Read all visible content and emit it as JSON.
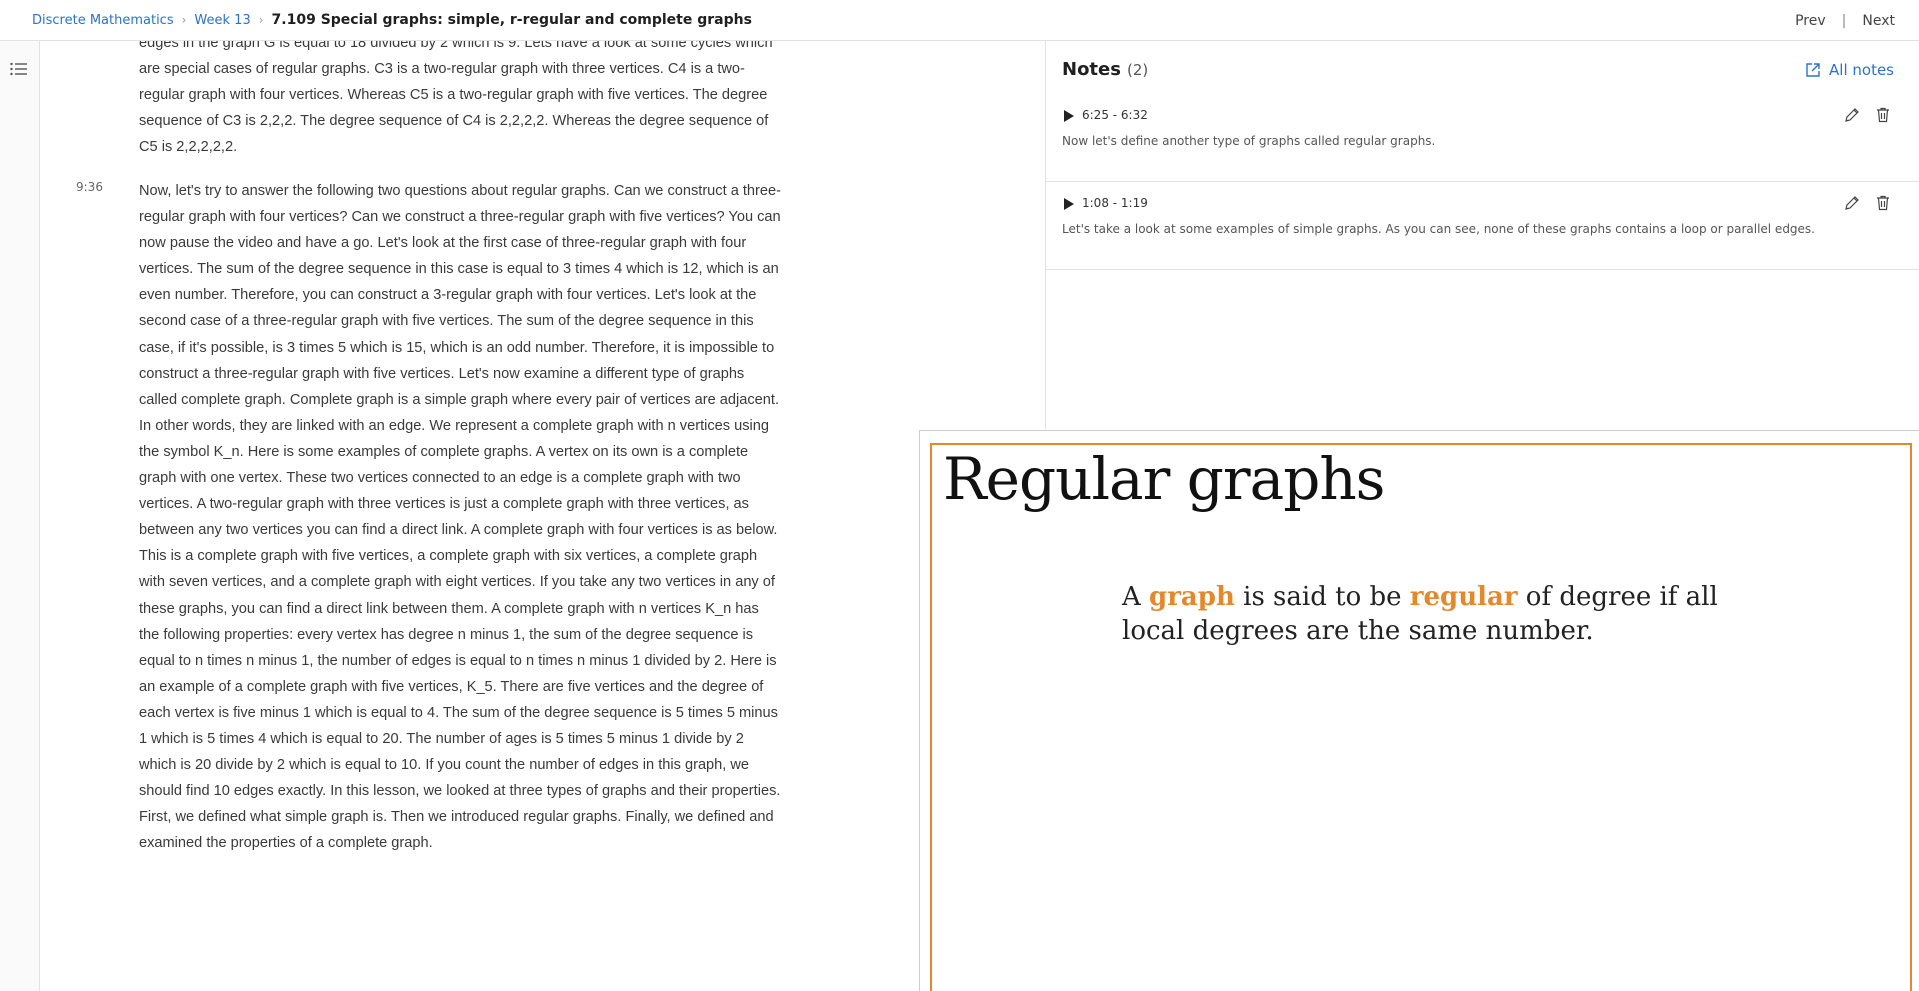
{
  "breadcrumb": {
    "course": "Discrete Mathematics",
    "week": "Week 13",
    "current": "7.109 Special graphs: simple, r-regular and complete graphs"
  },
  "nav": {
    "prev": "Prev",
    "divider": "|",
    "next": "Next"
  },
  "transcript": [
    {
      "timestamp": "",
      "text": "edges in the graph G is equal to 18 divided by 2 which is 9. Lets have a look at some cycles which are special cases of regular graphs. C3 is a two-regular graph with three vertices. C4 is a two-regular graph with four vertices. Whereas C5 is a two-regular graph with five vertices. The degree sequence of C3 is 2,2,2. The degree sequence of C4 is 2,2,2,2. Whereas the degree sequence of C5 is 2,2,2,2,2."
    },
    {
      "timestamp": "9:36",
      "text": "Now, let's try to answer the following two questions about regular graphs. Can we construct a three-regular graph with four vertices? Can we construct a three-regular graph with five vertices? You can now pause the video and have a go. Let's look at the first case of three-regular graph with four vertices. The sum of the degree sequence in this case is equal to 3 times 4 which is 12, which is an even number. Therefore, you can construct a 3-regular graph with four vertices. Let's look at the second case of a three-regular graph with five vertices. The sum of the degree sequence in this case, if it's possible, is 3 times 5 which is 15, which is an odd number. Therefore, it is impossible to construct a three-regular graph with five vertices. Let's now examine a different type of graphs called complete graph. Complete graph is a simple graph where every pair of vertices are adjacent. In other words, they are linked with an edge. We represent a complete graph with n vertices using the symbol K_n. Here is some examples of complete graphs. A vertex on its own is a complete graph with one vertex. These two vertices connected to an edge is a complete graph with two vertices. A two-regular graph with three vertices is just a complete graph with three vertices, as between any two vertices you can find a direct link. A complete graph with four vertices is as below. This is a complete graph with five vertices, a complete graph with six vertices, a complete graph with seven vertices, and a complete graph with eight vertices. If you take any two vertices in any of these graphs, you can find a direct link between them. A complete graph with n vertices K_n has the following properties: every vertex has degree n minus 1, the sum of the degree sequence is equal to n times n minus 1, the number of edges is equal to n times n minus 1 divided by 2. Here is an example of a complete graph with five vertices, K_5. There are five vertices and the degree of each vertex is five minus 1 which is equal to 4. The sum of the degree sequence is 5 times 5 minus 1 which is 5 times 4 which is equal to 20. The number of ages is 5 times 5 minus 1 divide by 2 which is 20 divide by 2 which is equal to 10. If you count the number of edges in this graph, we should find 10 edges exactly. In this lesson, we looked at three types of graphs and their properties. First, we defined what simple graph is. Then we introduced regular graphs. Finally, we defined and examined the properties of a complete graph."
    }
  ],
  "notes": {
    "title": "Notes",
    "count": "(2)",
    "all_notes_label": "All notes",
    "items": [
      {
        "time": "6:25 - 6:32",
        "text": "Now let's define another type of graphs called regular graphs."
      },
      {
        "time": "1:08 - 1:19",
        "text": "Let's take a look at some examples of simple graphs. As you can see, none of these graphs contains a loop or parallel edges."
      }
    ]
  },
  "slide": {
    "title": "Regular graphs",
    "body": {
      "part1": "A ",
      "hl1": "graph",
      "part2": " is said to be ",
      "hl2": "regular",
      "part3": " of degree if all local degrees are the same number."
    }
  },
  "colors": {
    "accent": "#e3892c",
    "link": "#2a73cc"
  },
  "icons": {
    "rail_toggle": "transcript-list-icon",
    "all_notes": "external-link-icon",
    "play": "play-icon",
    "edit": "pencil-icon",
    "delete": "trash-icon"
  }
}
